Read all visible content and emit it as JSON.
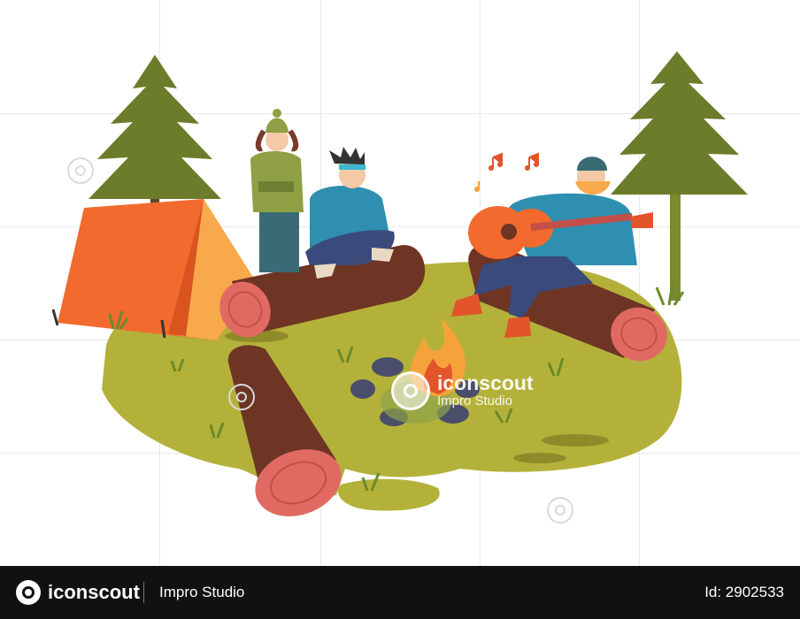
{
  "scene": {
    "description_icons": [
      "pine-tree",
      "tent",
      "campfire",
      "log",
      "guitar",
      "music-note"
    ]
  },
  "watermark": {
    "brand": "iconscout",
    "studio": "Impro Studio"
  },
  "footer": {
    "brand": "iconscout",
    "studio": "Impro Studio",
    "id_text": "Id: 2902533"
  },
  "colors": {
    "grass": "#b4b13a",
    "tree": "#6b7c2a",
    "tent": "#f26a2e",
    "log": "#6e3424",
    "log_cut": "#e06a62",
    "fire": "#f5a23a",
    "footer_bg": "#111111"
  }
}
